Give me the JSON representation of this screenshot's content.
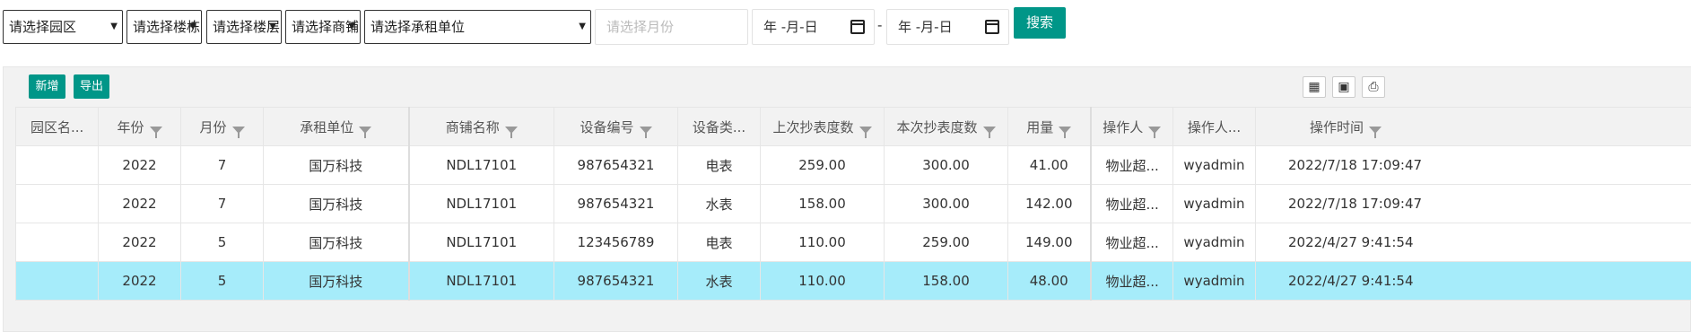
{
  "filters": {
    "park": "请选择园区",
    "building": "请选择楼栋",
    "floor": "请选择楼层",
    "shop": "请选择商铺",
    "tenant": "请选择承租单位",
    "month_placeholder": "请选择月份",
    "date_start": "年 -月-日",
    "date_end": "年 -月-日",
    "date_sep": "-",
    "search_label": "搜索"
  },
  "toolbar": {
    "add_label": "新增",
    "export_label": "导出",
    "icons": [
      "columns-icon",
      "export-icon",
      "print-icon"
    ]
  },
  "table": {
    "columns": [
      "园区名...",
      "年份",
      "月份",
      "承租单位",
      "商铺名称",
      "设备编号",
      "设备类...",
      "上次抄表度数",
      "本次抄表度数",
      "用量",
      "操作人",
      "操作人...",
      "操作时间"
    ],
    "rows": [
      [
        "",
        "2022",
        "7",
        "国万科技",
        "NDL17101",
        "987654321",
        "电表",
        "259.00",
        "300.00",
        "41.00",
        "物业超...",
        "wyadmin",
        "2022/7/18 17:09:47"
      ],
      [
        "",
        "2022",
        "7",
        "国万科技",
        "NDL17101",
        "987654321",
        "水表",
        "158.00",
        "300.00",
        "142.00",
        "物业超...",
        "wyadmin",
        "2022/7/18 17:09:47"
      ],
      [
        "",
        "2022",
        "5",
        "国万科技",
        "NDL17101",
        "123456789",
        "电表",
        "110.00",
        "259.00",
        "149.00",
        "物业超...",
        "wyadmin",
        "2022/4/27 9:41:54"
      ],
      [
        "",
        "2022",
        "5",
        "国万科技",
        "NDL17101",
        "987654321",
        "水表",
        "110.00",
        "158.00",
        "48.00",
        "物业超...",
        "wyadmin",
        "2022/4/27 9:41:54"
      ]
    ],
    "selected_row": 3
  },
  "colors": {
    "accent": "#009688",
    "selected_row": "#a6ecfa"
  }
}
